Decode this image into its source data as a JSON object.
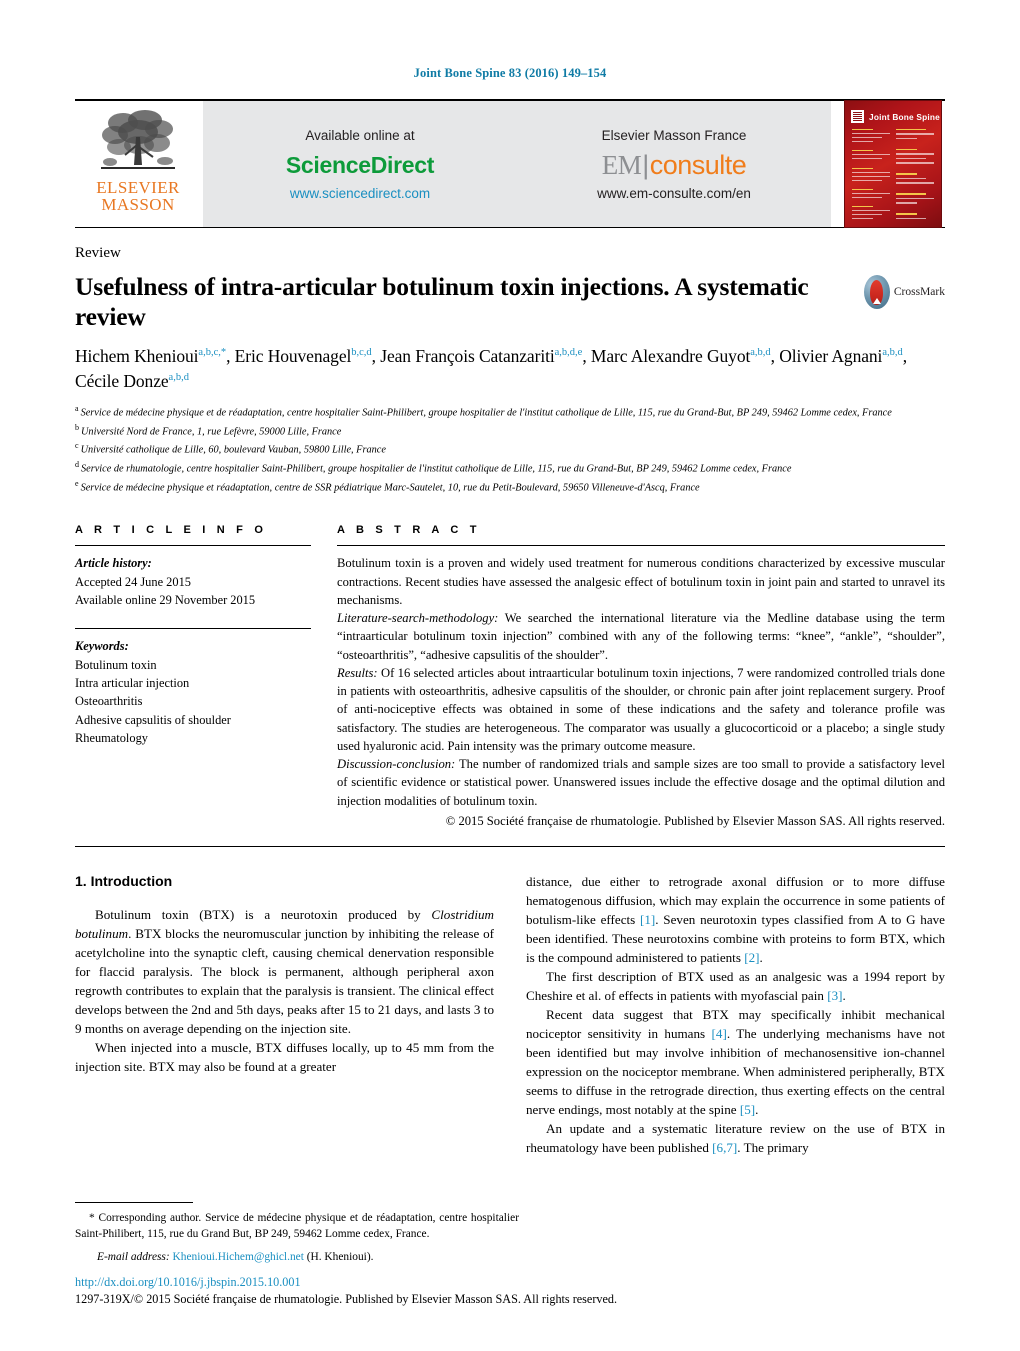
{
  "journal_ref": "Joint Bone Spine 83 (2016) 149–154",
  "masthead": {
    "publisher_logo": "ELSEVIER",
    "publisher_logo2": "MASSON",
    "left_panel": {
      "top": "Available online at",
      "logo": "ScienceDirect",
      "url": "www.sciencedirect.com"
    },
    "right_panel": {
      "top": "Elsevier Masson France",
      "logo_em": "EM",
      "logo_consulte": "consulte",
      "url": "www.em-consulte.com/en"
    },
    "cover_title": "Joint Bone Spine"
  },
  "article": {
    "kind": "Review",
    "title": "Usefulness of intra-articular botulinum toxin injections. A systematic review",
    "crossmark_label": "CrossMark",
    "authors": [
      {
        "name": "Hichem Khenioui",
        "marks": "a,b,c,*",
        "sep": ", "
      },
      {
        "name": "Eric Houvenagel",
        "marks": "b,c,d",
        "sep": ", "
      },
      {
        "name": "Jean François Catanzariti",
        "marks": "a,b,d,e",
        "sep": ", "
      },
      {
        "name": "Marc Alexandre Guyot",
        "marks": "a,b,d",
        "sep": ", "
      },
      {
        "name": "Olivier Agnani",
        "marks": "a,b,d",
        "sep": ", "
      },
      {
        "name": "Cécile Donze",
        "marks": "a,b,d",
        "sep": ""
      }
    ],
    "affiliations": [
      {
        "label": "a",
        "text": "Service de médecine physique et de réadaptation, centre hospitalier Saint-Philibert, groupe hospitalier de l'institut catholique de Lille, 115, rue du Grand-But, BP 249, 59462 Lomme cedex, France"
      },
      {
        "label": "b",
        "text": "Université Nord de France, 1, rue Lefèvre, 59000 Lille, France"
      },
      {
        "label": "c",
        "text": "Université catholique de Lille, 60, boulevard Vauban, 59800 Lille, France"
      },
      {
        "label": "d",
        "text": "Service de rhumatologie, centre hospitalier Saint-Philibert, groupe hospitalier de l'institut catholique de Lille, 115, rue du Grand-But, BP 249, 59462 Lomme cedex, France"
      },
      {
        "label": "e",
        "text": "Service de médecine physique et réadaptation, centre de SSR pédiatrique Marc-Sautelet, 10, rue du Petit-Boulevard, 59650 Villeneuve-d'Ascq, France"
      }
    ]
  },
  "article_info": {
    "heading": "A R T I C L E   I N F O",
    "history_label": "Article history:",
    "history": [
      "Accepted 24 June 2015",
      "Available online 29 November 2015"
    ],
    "keywords_label": "Keywords:",
    "keywords": [
      "Botulinum toxin",
      "Intra articular injection",
      "Osteoarthritis",
      "Adhesive capsulitis of shoulder",
      "Rheumatology"
    ]
  },
  "abstract": {
    "heading": "A B S T R A C T",
    "intro": "Botulinum toxin is a proven and widely used treatment for numerous conditions characterized by excessive muscular contractions. Recent studies have assessed the analgesic effect of botulinum toxin in joint pain and started to unravel its mechanisms.",
    "methods_label": "Literature-search-methodology:",
    "methods": " We searched the international literature via the Medline database using the term “intraarticular botulinum toxin injection” combined with any of the following terms: “knee”, “ankle”, “shoulder”, “osteoarthritis”, “adhesive capsulitis of the shoulder”.",
    "results_label": "Results:",
    "results": " Of 16 selected articles about intraarticular botulinum toxin injections, 7 were randomized controlled trials done in patients with osteoarthritis, adhesive capsulitis of the shoulder, or chronic pain after joint replacement surgery. Proof of anti-nociceptive effects was obtained in some of these indications and the safety and tolerance profile was satisfactory. The studies are heterogeneous. The comparator was usually a glucocorticoid or a placebo; a single study used hyaluronic acid. Pain intensity was the primary outcome measure.",
    "discussion_label": "Discussion-conclusion:",
    "discussion": " The number of randomized trials and sample sizes are too small to provide a satisfactory level of scientific evidence or statistical power. Unanswered issues include the effective dosage and the optimal dilution and injection modalities of botulinum toxin.",
    "copyright": "© 2015 Société française de rhumatologie. Published by Elsevier Masson SAS. All rights reserved."
  },
  "body": {
    "section_heading": "1. Introduction",
    "left_p1_a": "Botulinum toxin (BTX) is a neurotoxin produced by ",
    "left_p1_italic": "Clostridium botulinum",
    "left_p1_b": ". BTX blocks the neuromuscular junction by inhibiting the release of acetylcholine into the synaptic cleft, causing chemical denervation responsible for flaccid paralysis. The block is permanent, although peripheral axon regrowth contributes to explain that the paralysis is transient. The clinical effect develops between the 2nd and 5th days, peaks after 15 to 21 days, and lasts 3 to 9 months on average depending on the injection site.",
    "left_p2": "When injected into a muscle, BTX diffuses locally, up to 45 mm from the injection site. BTX may also be found at a greater",
    "right_p1_a": "distance, due either to retrograde axonal diffusion or to more diffuse hematogenous diffusion, which may explain the occurrence in some patients of botulism-like effects ",
    "right_p1_ref1": "[1]",
    "right_p1_b": ". Seven neurotoxin types classified from A to G have been identified. These neurotoxins combine with proteins to form BTX, which is the compound administered to patients ",
    "right_p1_ref2": "[2]",
    "right_p1_c": ".",
    "right_p2_a": "The first description of BTX used as an analgesic was a 1994 report by Cheshire et al. of effects in patients with myofascial pain ",
    "right_p2_ref": "[3]",
    "right_p2_b": ".",
    "right_p3_a": "Recent data suggest that BTX may specifically inhibit mechanical nociceptor sensitivity in humans ",
    "right_p3_ref1": "[4]",
    "right_p3_b": ". The underlying mechanisms have not been identified but may involve inhibition of mechanosensitive ion-channel expression on the nociceptor membrane. When administered peripherally, BTX seems to diffuse in the retrograde direction, thus exerting effects on the central nerve endings, most notably at the spine ",
    "right_p3_ref2": "[5]",
    "right_p3_c": ".",
    "right_p4_a": "An update and a systematic literature review on the use of BTX in rheumatology have been published ",
    "right_p4_ref": "[6,7]",
    "right_p4_b": ". The primary"
  },
  "footnote": {
    "marker": "*",
    "text": " Corresponding author. Service de médecine physique et de réadaptation, centre hospitalier Saint-Philibert, 115, rue du Grand But, BP 249, 59462 Lomme cedex, France.",
    "email_label": "E-mail address:",
    "email": "Khenioui.Hichem@ghicl.net",
    "email_suffix": " (H. Khenioui)."
  },
  "colophon": {
    "doi": "http://dx.doi.org/10.1016/j.jbspin.2015.10.001",
    "issn": "1297-319X/© 2015 Société française de rhumatologie. Published by Elsevier Masson SAS. All rights reserved."
  },
  "colors": {
    "link": "#1a8fc1",
    "journal": "#0f7ba5",
    "sciencedirect": "#0d9b3a",
    "consulte": "#f07d1b",
    "elsevier": "#e87722"
  }
}
